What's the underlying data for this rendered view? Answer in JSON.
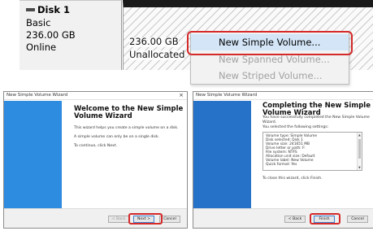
{
  "disk": {
    "name": "Disk 1",
    "type": "Basic",
    "size": "236.00 GB",
    "status": "Online"
  },
  "unallocated": {
    "size": "236.00 GB",
    "label": "Unallocated"
  },
  "context_menu": {
    "items": [
      {
        "label": "New Simple Volume...",
        "state": "highlighted"
      },
      {
        "label": "New Spanned Volume...",
        "state": "disabled"
      },
      {
        "label": "New Striped Volume...",
        "state": "disabled"
      }
    ]
  },
  "wizard_welcome": {
    "window_title": "New Simple Volume Wizard",
    "close_glyph": "×",
    "heading_line1": "Welcome to the New Simple",
    "heading_line2": "Volume Wizard",
    "para1": "This wizard helps you create a simple volume on a disk.",
    "para2": "A simple volume can only be on a single disk.",
    "para3": "To continue, click Next.",
    "btn_back": "< Back",
    "btn_next": "Next >",
    "btn_cancel": "Cancel"
  },
  "wizard_complete": {
    "window_title": "New Simple Volume Wizard",
    "heading_line1": "Completing the New Simple",
    "heading_line2": "Volume Wizard",
    "intro_line1": "You have successfully completed the New Simple Volume",
    "intro_line2": "Wizard.",
    "settings_intro": "You selected the following settings:",
    "summary": [
      "Volume type: Simple Volume",
      "Disk selected: Disk 1",
      "Volume size: 241651 MB",
      "Drive letter or path: F:",
      "File system: NTFS",
      "Allocation unit size: Default",
      "Volume label: New Volume",
      "Quick format: Yes"
    ],
    "close_text": "To close this wizard, click Finish.",
    "btn_back": "< Back",
    "btn_finish": "Finish",
    "btn_cancel": "Cancel"
  },
  "colors": {
    "highlight_box": "#d42a2a",
    "menu_highlight": "#d3e5f7",
    "wizard_banner": "#2d8be0"
  }
}
